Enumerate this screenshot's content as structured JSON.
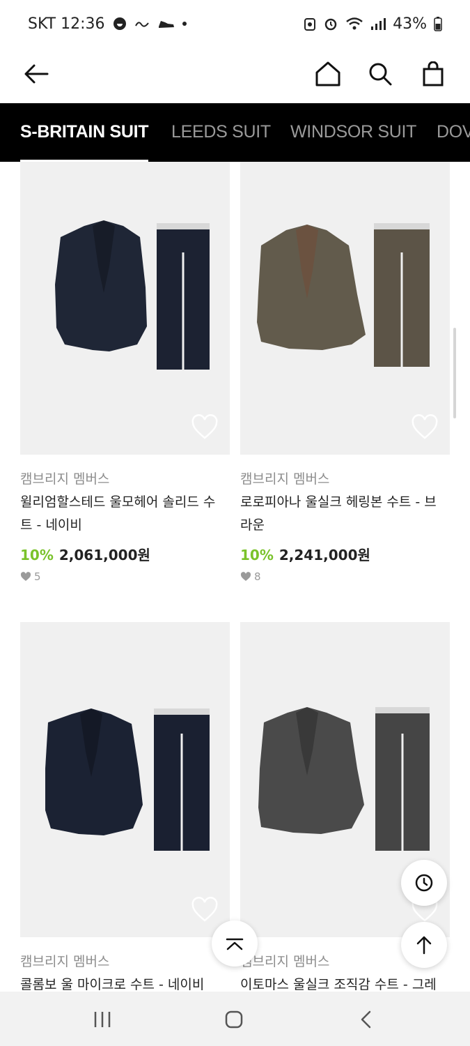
{
  "status_bar": {
    "carrier_time": "SKT 12:36",
    "battery": "43%"
  },
  "header": {
    "back_icon": "arrow-left-icon",
    "home_icon": "home-icon",
    "search_icon": "search-icon",
    "cart_icon": "shopping-bag-icon"
  },
  "tabs": [
    {
      "label": "S-BRITAIN SUIT",
      "active": true
    },
    {
      "label": "LEEDS SUIT",
      "active": false
    },
    {
      "label": "WINDSOR SUIT",
      "active": false
    },
    {
      "label": "DOV",
      "active": false
    }
  ],
  "products": [
    {
      "brand": "캠브리지 멤버스",
      "name": "윌리엄할스테드 울모헤어 솔리드 수트 - 네이비",
      "discount": "10%",
      "price": "2,061,000원",
      "likes": "5",
      "jacket_color": "#1f2636",
      "pants_color": "#1c2232"
    },
    {
      "brand": "캠브리지 멤버스",
      "name": "로로피아나 울실크 헤링본 수트 - 브라운",
      "discount": "10%",
      "price": "2,241,000원",
      "likes": "8",
      "jacket_color": "#625b4c",
      "pants_color": "#5c5447"
    },
    {
      "brand": "캠브리지 멤버스",
      "name": "콜롬보 울 마이크로 수트 - 네이비",
      "jacket_color": "#1b2233",
      "pants_color": "#1a2031"
    },
    {
      "brand": "캠브리지 멤버스",
      "name": "이토마스 울실크 조직감 수트 - 그레",
      "jacket_color": "#4a4a4a",
      "pants_color": "#454545"
    }
  ],
  "colors": {
    "discount": "#7ac22b",
    "tab_bar": "#000000",
    "image_bg": "#f0f0f0"
  },
  "floating": {
    "recent_icon": "clock-icon",
    "scroll_top_icon": "arrow-up-icon",
    "collapse_icon": "chevron-up-icon"
  },
  "nav": {
    "recents_icon": "recent-apps-icon",
    "home_icon": "home-circle-icon",
    "back_icon": "back-chevron-icon"
  }
}
